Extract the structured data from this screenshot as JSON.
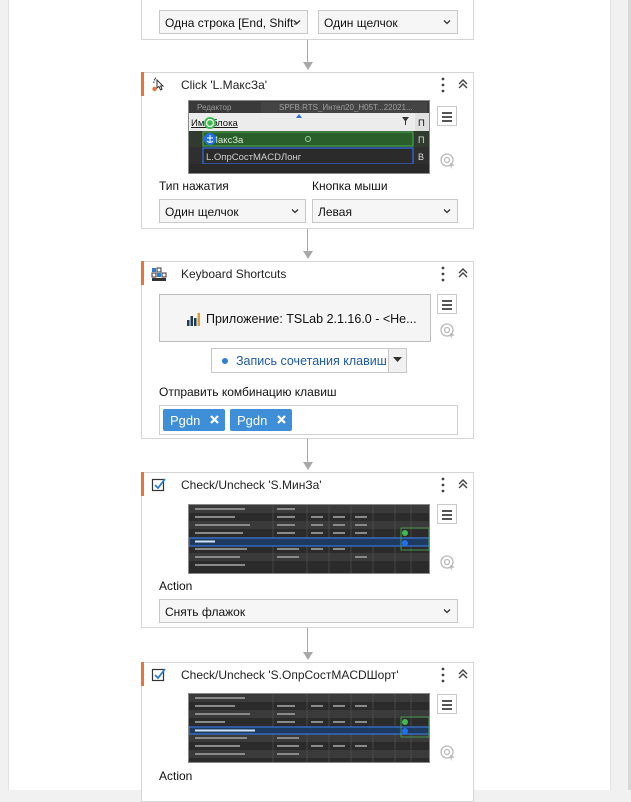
{
  "top_card": {
    "select_left": "Одна строка [End, Shift-",
    "select_right": "Один щелчок"
  },
  "click_card": {
    "title": "Click 'L.МаксЗа'",
    "icon": "click-icon",
    "shot": {
      "tab1": "Редактор",
      "tab2": "SPFB.RTS_Интел20_H05T...22021...",
      "header_col": "Имя блока",
      "header_col2": "П",
      "row1": "МаксЗа",
      "row1_right": "П",
      "row2": "L.ОпрСостMACDЛонг",
      "row2_right": "В"
    },
    "label_click_type": "Тип нажатия",
    "label_mouse_button": "Кнопка мыши",
    "click_type_value": "Один щелчок",
    "mouse_button_value": "Левая"
  },
  "keyboard_card": {
    "title": "Keyboard Shortcuts",
    "icon": "keyboard-shortcut-icon",
    "app_text": "Приложение: TSLab 2.1.16.0 - <He...",
    "record_text": "Запись сочетания клавиш",
    "send_label": "Отправить комбинацию клавиш",
    "keys": [
      "Pgdn",
      "Pgdn"
    ]
  },
  "check_card1": {
    "title": "Check/Uncheck 'S.МинЗа'",
    "icon": "checkbox-icon",
    "action_label": "Action",
    "action_value": "Снять флажок"
  },
  "check_card2": {
    "title": "Check/Uncheck 'S.ОпрСостMACDШорт'",
    "icon": "checkbox-icon",
    "action_label": "Action"
  },
  "colors": {
    "accent": "#e8743b",
    "chip": "#3f8fd8",
    "link": "#1d5aa0",
    "highlight_green": "#2d6a2d"
  }
}
